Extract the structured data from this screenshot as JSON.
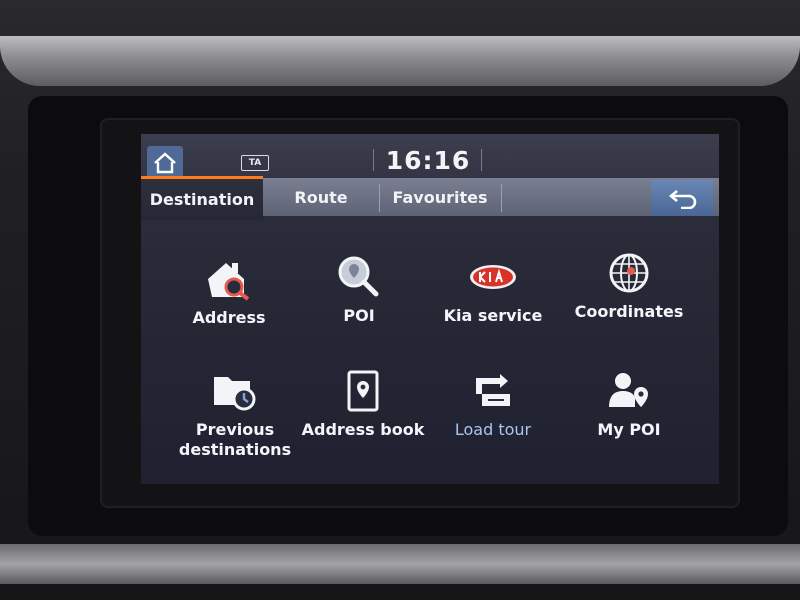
{
  "status": {
    "time": "16:16",
    "ta_badge": "TA"
  },
  "tabs": [
    {
      "label": "Destination",
      "active": true
    },
    {
      "label": "Route",
      "active": false
    },
    {
      "label": "Favourites",
      "active": false
    }
  ],
  "menu": {
    "items": [
      {
        "label": "Address",
        "icon": "house-search-icon"
      },
      {
        "label": "POI",
        "icon": "magnifier-pin-icon"
      },
      {
        "label": "Kia service",
        "icon": "kia-logo-icon"
      },
      {
        "label": "Coordinates",
        "icon": "globe-target-icon"
      },
      {
        "label": "Previous destinations",
        "icon": "folder-clock-icon"
      },
      {
        "label": "Address book",
        "icon": "book-pin-icon"
      },
      {
        "label": "Load tour",
        "icon": "load-tour-icon"
      },
      {
        "label": "My POI",
        "icon": "person-pin-icon"
      }
    ]
  },
  "colors": {
    "accent": "#ff7a1a",
    "button_blue": "#4f6a96",
    "kia_red": "#d8332a"
  }
}
